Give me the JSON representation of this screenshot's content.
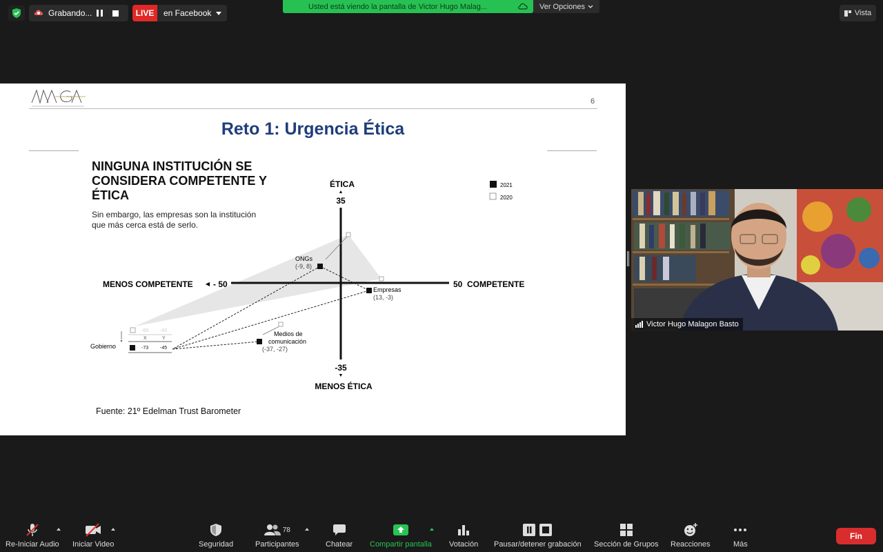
{
  "top_bar": {
    "recording_label": "Grabando...",
    "live_badge": "LIVE",
    "live_label": "en Facebook",
    "share_banner": "Usted está viendo la pantalla de Victor Hugo Malag...",
    "options_label": "Ver Opciones",
    "view_label": "Vista"
  },
  "slide": {
    "page_number": "6",
    "title": "Reto 1: Urgencia Ética",
    "headline": "NINGUNA INSTITUCIÓN SE CONSIDERA COMPETENTE Y ÉTICA",
    "subhead": "Sin embargo, las empresas son la institución que más cerca está de serlo.",
    "source": "Fuente: 21º  Edelman Trust Barometer",
    "logo_text": "ΛΛGΛ"
  },
  "chart_data": {
    "type": "scatter",
    "title": "",
    "xlabel_positive": "COMPETENTE",
    "xlabel_negative": "MENOS COMPETENTE",
    "ylabel_positive": "ÉTICA",
    "ylabel_negative": "MENOS ÉTICA",
    "x_tick_min": "- 50",
    "x_tick_max": "50",
    "y_tick_max": "35",
    "y_tick_min": "-35",
    "xlim": [
      -50,
      50
    ],
    "ylim": [
      -35,
      35
    ],
    "legend": [
      "2021",
      "2020"
    ],
    "legend_position": "top-right",
    "points_2021": [
      {
        "name": "ONGs",
        "label": "(-9, 8)",
        "x": -9,
        "y": 8
      },
      {
        "name": "Empresas",
        "label": "(13, -3)",
        "x": 13,
        "y": -3
      },
      {
        "name": "Medios de comunicación",
        "label": "(-37, -27)",
        "x": -37,
        "y": -27
      },
      {
        "name": "Gobierno",
        "label": "",
        "x": -73,
        "y": -45
      }
    ],
    "points_2020": [
      {
        "name": "ONGs",
        "x": 3,
        "y": 19
      },
      {
        "name": "Empresas",
        "x": 15,
        "y": 1
      },
      {
        "name": "Medios de comunicación",
        "x": -26,
        "y": -16
      },
      {
        "name": "Gobierno",
        "x": -69,
        "y": -43
      }
    ],
    "gobierno_table": {
      "header": [
        "X",
        "Y"
      ],
      "row_2020": [
        "-69",
        "-43"
      ],
      "row_2021": [
        "-73",
        "-45"
      ],
      "row_label": "Gobierno"
    }
  },
  "video": {
    "participant_name": "Victor Hugo Malagon Basto"
  },
  "toolbar": {
    "audio_label": "Re-Iniciar Audio",
    "video_label": "Iniciar Video",
    "security_label": "Seguridad",
    "participants_label": "Participantes",
    "participants_count": "78",
    "chat_label": "Chatear",
    "share_label": "Compartir pantalla",
    "poll_label": "Votación",
    "record_label": "Pausar/detener grabación",
    "breakout_label": "Sección de Grupos",
    "reactions_label": "Reacciones",
    "more_label": "Más",
    "end_label": "Fin"
  }
}
